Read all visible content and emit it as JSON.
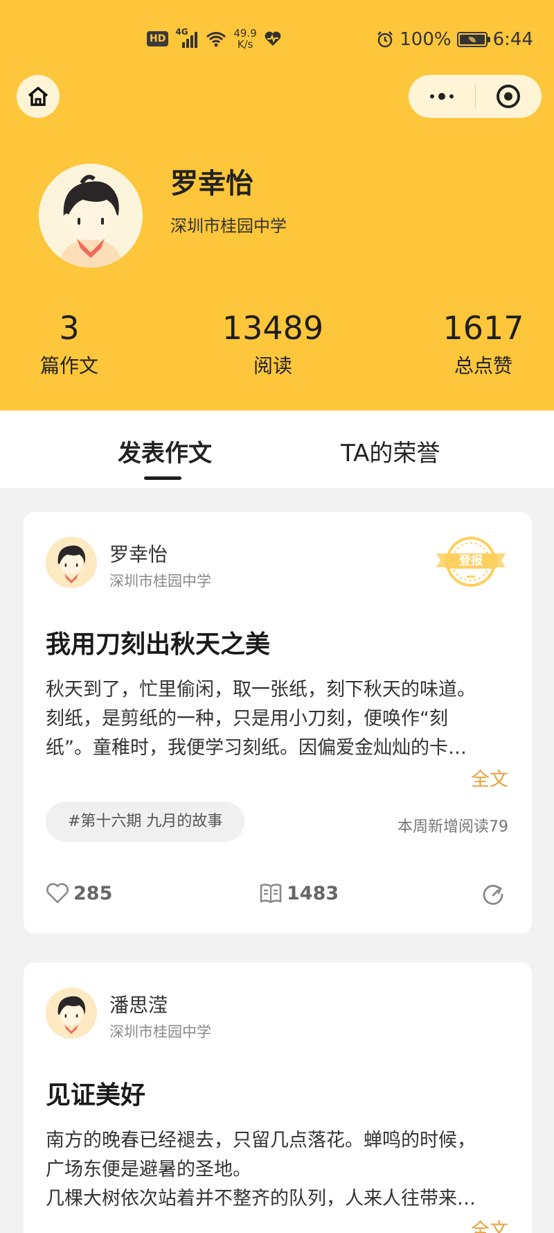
{
  "status_bar": {
    "hd": "HD",
    "network": "4G",
    "speed_value": "49.9",
    "speed_unit": "K/s",
    "battery": "100%",
    "time": "6:44"
  },
  "nav": {
    "home_icon": "home-icon",
    "more_icon": "more-dots-icon",
    "close_icon": "target-icon"
  },
  "profile": {
    "name": "罗幸怡",
    "school": "深圳市桂园中学",
    "stats": [
      {
        "value": "3",
        "label": "篇作文"
      },
      {
        "value": "13489",
        "label": "阅读"
      },
      {
        "value": "1617",
        "label": "总点赞"
      }
    ]
  },
  "tabs": [
    {
      "label": "发表作文",
      "active": true
    },
    {
      "label": "TA的荣誉",
      "active": false
    }
  ],
  "posts": [
    {
      "author": "罗幸怡",
      "school": "深圳市桂园中学",
      "badge": "登报",
      "title": "我用刀刻出秋天之美",
      "lines": [
        "秋天到了，忙里偷闲，取一张纸，刻下秋天的味道。",
        "刻纸，是剪纸的一种，只是用小刀刻，便唤作“刻",
        "纸”。童稚时，我便学习刻纸。因偏爱金灿灿的卡…"
      ],
      "full_text": "全文",
      "tag": "#第十六期 九月的故事",
      "weekly_reads": "本周新增阅读79",
      "likes": "285",
      "reads": "1483"
    },
    {
      "author": "潘思滢",
      "school": "深圳市桂园中学",
      "title": "见证美好",
      "lines": [
        "南方的晚春已经褪去，只留几点落花。蝉鸣的时候，",
        "广场东便是避暑的圣地。",
        "几棵大树依次站着并不整齐的队列，人来人往带来…"
      ],
      "full_text": "全文"
    }
  ],
  "colors": {
    "header_bg": "#fdc63b",
    "accent": "#e8a23a"
  }
}
